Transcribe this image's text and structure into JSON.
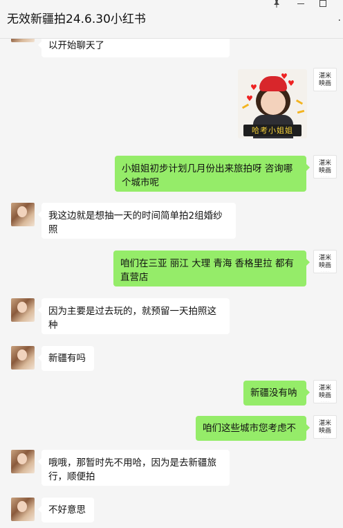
{
  "window": {
    "title": "无效新疆拍24.6.30小红书",
    "pin_icon": "pin-icon",
    "minimize_icon": "minimize-icon",
    "maximize_icon": "maximize-icon",
    "more_icon": "more-icon"
  },
  "contact_avatar": {
    "label": "tunmi-logo"
  },
  "brand_avatar": {
    "line1": "湛米",
    "line2": "映画",
    "sub": "· · · · ·"
  },
  "messages": [
    {
      "side": "left",
      "text": "以开始聊天了"
    },
    {
      "side": "right",
      "type": "sticker",
      "caption": "哈考小姐姐"
    },
    {
      "side": "right",
      "text": "小姐姐初步计划几月份出来旅拍呀 咨询哪个城市呢"
    },
    {
      "side": "left",
      "text": "我这边就是想抽一天的时间简单拍2组婚纱照"
    },
    {
      "side": "right",
      "text": "咱们在三亚 丽江 大理 青海 香格里拉 都有直营店"
    },
    {
      "side": "left",
      "text": "因为主要是过去玩的，就预留一天拍照这种"
    },
    {
      "side": "left",
      "text": "新疆有吗"
    },
    {
      "side": "right",
      "text": "新疆没有呐"
    },
    {
      "side": "right",
      "text": "咱们这些城市您考虑不"
    },
    {
      "side": "left",
      "text": "哦哦，那暂时先不用哈，因为是去新疆旅行，顺便拍"
    },
    {
      "side": "left",
      "text": "不好意思"
    }
  ]
}
